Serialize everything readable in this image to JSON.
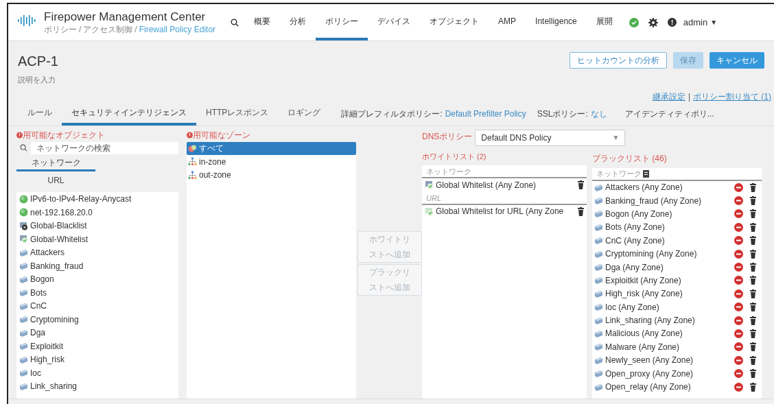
{
  "header": {
    "product": "Firepower Management Center",
    "breadcrumb": [
      "ポリシー",
      "/",
      "アクセス制御",
      "/"
    ],
    "breadcrumb_current": "Firewall Policy Editor",
    "nav": [
      {
        "label": "概要",
        "selected": false
      },
      {
        "label": "分析",
        "selected": false
      },
      {
        "label": "ポリシー",
        "selected": true
      },
      {
        "label": "デバイス",
        "selected": false
      },
      {
        "label": "オブジェクト",
        "selected": false
      },
      {
        "label": "AMP",
        "selected": false
      },
      {
        "label": "Intelligence",
        "selected": false
      },
      {
        "label": "展開",
        "selected": false
      }
    ],
    "user": "admin",
    "user_caret": "▼"
  },
  "policy": {
    "name": "ACP-1",
    "description": "説明を入力",
    "buttons": [
      {
        "label": "ヒットカウントの分析",
        "kind": "outline",
        "disabled": false
      },
      {
        "label": "保存",
        "kind": "primary",
        "disabled": true
      },
      {
        "label": "キャンセル",
        "kind": "primary",
        "disabled": false
      }
    ],
    "links": [
      "継承設定",
      "ポリシー割り当て (1)"
    ],
    "link_separator": "|"
  },
  "tabs": [
    {
      "label": "ルール",
      "selected": false
    },
    {
      "label": "セキュリティインテリジェンス",
      "selected": true
    },
    {
      "label": "HTTPレスポンス",
      "selected": false
    },
    {
      "label": "ロギング",
      "selected": false
    }
  ],
  "tab_settings": [
    {
      "label": "詳細プレフィルタポリシー:",
      "value": "Default Prefilter Policy"
    },
    {
      "label": "SSLポリシー:",
      "value": "なし"
    }
  ],
  "tab_overflow": "アイデンティティポリ...",
  "objects": {
    "title": "用可能なオブジェクト",
    "search": {
      "placeholder": "ネットワークの検索"
    },
    "subtabs": [
      {
        "label": "ネットワーク",
        "selected": true
      },
      {
        "label": "URL",
        "selected": false
      }
    ],
    "items": [
      {
        "label": "IPv6-to-IPv4-Relay-Anycast",
        "kind": "network"
      },
      {
        "label": "net-192.168.20.0",
        "kind": "network"
      },
      {
        "label": "Global-Blacklist",
        "kind": "blacklist"
      },
      {
        "label": "Global-Whitelist",
        "kind": "whitelist"
      },
      {
        "label": "Attackers",
        "kind": "feed"
      },
      {
        "label": "Banking_fraud",
        "kind": "feed"
      },
      {
        "label": "Bogon",
        "kind": "feed"
      },
      {
        "label": "Bots",
        "kind": "feed"
      },
      {
        "label": "CnC",
        "kind": "feed"
      },
      {
        "label": "Cryptomining",
        "kind": "feed"
      },
      {
        "label": "Dga",
        "kind": "feed"
      },
      {
        "label": "Exploitkit",
        "kind": "feed"
      },
      {
        "label": "High_risk",
        "kind": "feed"
      },
      {
        "label": "Ioc",
        "kind": "feed"
      },
      {
        "label": "Link_sharing",
        "kind": "feed"
      }
    ]
  },
  "zones": {
    "title": "用可能なゾーン",
    "items": [
      {
        "label": "すべて",
        "kind": "all",
        "selected": true
      },
      {
        "label": "in-zone",
        "kind": "zone",
        "selected": false
      },
      {
        "label": "out-zone",
        "kind": "zone",
        "selected": false
      }
    ]
  },
  "add_buttons": [
    {
      "lines": [
        "ホワイトリ",
        "ストへ追加"
      ],
      "disabled": true
    },
    {
      "lines": [
        "ブラックリ",
        "ストへ追加"
      ],
      "disabled": true
    }
  ],
  "dns": {
    "label": "DNSポリシー",
    "value": "Default DNS Policy",
    "caret": "▼"
  },
  "whitelist": {
    "title": "ホワイトリスト (2)",
    "sections": [
      {
        "header": "ネットワーク",
        "items": [
          {
            "label": "Global Whitelist (Any Zone)",
            "kind": "whitelist"
          }
        ]
      },
      {
        "header": "URL",
        "items": [
          {
            "label": "Global Whitelist for URL (Any Zone",
            "kind": "url_whitelist"
          }
        ]
      }
    ]
  },
  "blacklist": {
    "title": "ブラックリスト (46)",
    "header": "ネットワーク",
    "items": [
      {
        "label": "Attackers (Any Zone)"
      },
      {
        "label": "Banking_fraud (Any Zone)"
      },
      {
        "label": "Bogon (Any Zone)"
      },
      {
        "label": "Bots (Any Zone)"
      },
      {
        "label": "CnC (Any Zone)"
      },
      {
        "label": "Cryptomining (Any Zone)"
      },
      {
        "label": "Dga (Any Zone)"
      },
      {
        "label": "Exploitkit (Any Zone)"
      },
      {
        "label": "High_risk (Any Zone)"
      },
      {
        "label": "Ioc (Any Zone)"
      },
      {
        "label": "Link_sharing (Any Zone)"
      },
      {
        "label": "Malicious (Any Zone)"
      },
      {
        "label": "Malware (Any Zone)"
      },
      {
        "label": "Newly_seen (Any Zone)"
      },
      {
        "label": "Open_proxy (Any Zone)"
      },
      {
        "label": "Open_relay (Any Zone)"
      }
    ]
  }
}
